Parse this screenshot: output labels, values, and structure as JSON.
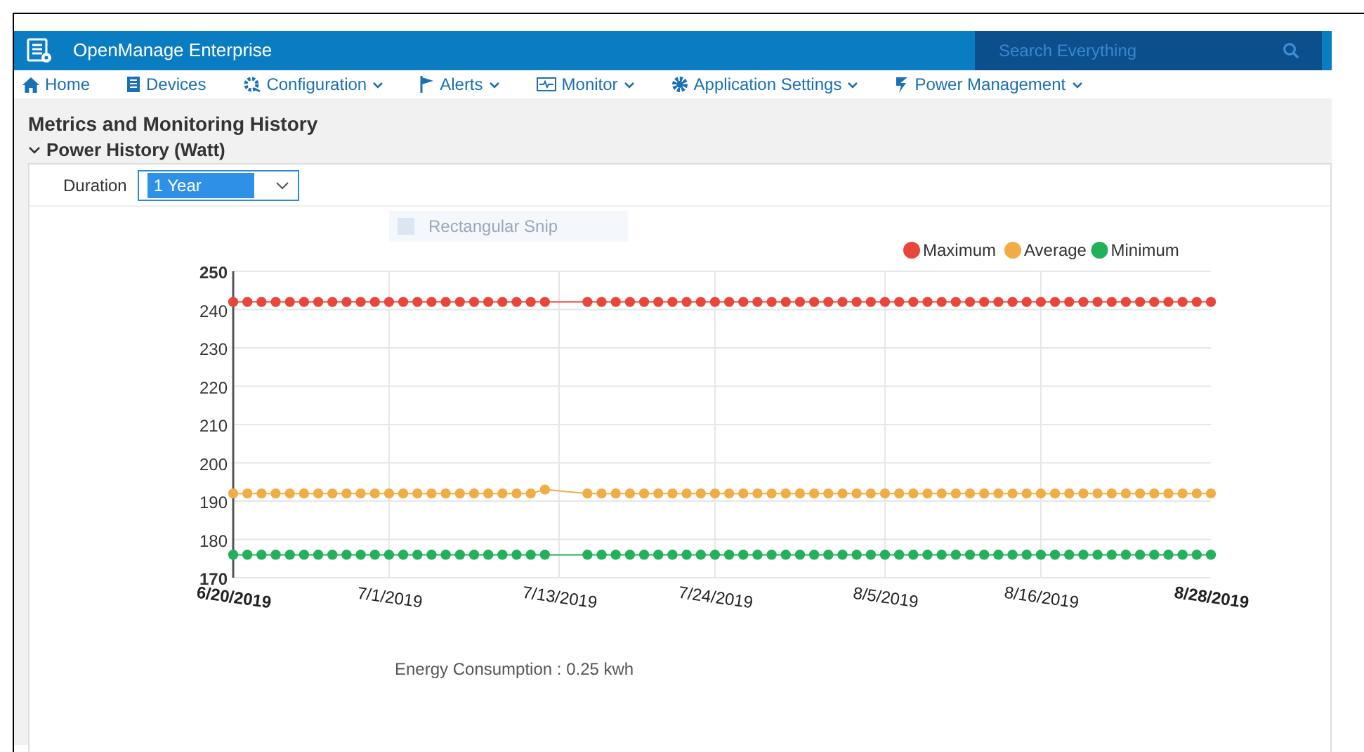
{
  "app": {
    "title": "OpenManage Enterprise",
    "search": {
      "placeholder": "Search Everything"
    }
  },
  "nav": [
    {
      "label": "Home",
      "dropdown": false
    },
    {
      "label": "Devices",
      "dropdown": false
    },
    {
      "label": "Configuration",
      "dropdown": true
    },
    {
      "label": "Alerts",
      "dropdown": true
    },
    {
      "label": "Monitor",
      "dropdown": true
    },
    {
      "label": "Application Settings",
      "dropdown": true
    },
    {
      "label": "Power Management",
      "dropdown": true
    }
  ],
  "page": {
    "title": "Metrics and Monitoring History"
  },
  "section": {
    "title": "Power History (Watt)",
    "expanded": true
  },
  "duration": {
    "label": "Duration",
    "value": "1 Year"
  },
  "snip_overlay": {
    "label": "Rectangular Snip"
  },
  "chart": {
    "chart_data": {
      "type": "line",
      "categories": [
        "6/20/2019",
        null,
        null,
        null,
        null,
        null,
        null,
        null,
        null,
        null,
        null,
        "7/1/2019",
        null,
        null,
        null,
        null,
        null,
        null,
        null,
        null,
        null,
        null,
        null,
        "7/13/2019",
        null,
        null,
        null,
        null,
        null,
        null,
        null,
        null,
        null,
        null,
        "7/24/2019",
        null,
        null,
        null,
        null,
        null,
        null,
        null,
        null,
        null,
        null,
        null,
        "8/5/2019",
        null,
        null,
        null,
        null,
        null,
        null,
        null,
        null,
        null,
        null,
        "8/16/2019",
        null,
        null,
        null,
        null,
        null,
        null,
        null,
        null,
        null,
        null,
        null,
        "8/28/2019"
      ],
      "series": [
        {
          "name": "Maximum",
          "color": "#e8463a",
          "marker": "circle",
          "values": [
            242,
            242,
            242,
            242,
            242,
            242,
            242,
            242,
            242,
            242,
            242,
            242,
            242,
            242,
            242,
            242,
            242,
            242,
            242,
            242,
            242,
            242,
            242,
            null,
            null,
            242,
            242,
            242,
            242,
            242,
            242,
            242,
            242,
            242,
            242,
            242,
            242,
            242,
            242,
            242,
            242,
            242,
            242,
            242,
            242,
            242,
            242,
            242,
            242,
            242,
            242,
            242,
            242,
            242,
            242,
            242,
            242,
            242,
            242,
            242,
            242,
            242,
            242,
            242,
            242,
            242,
            242,
            242,
            242,
            242
          ]
        },
        {
          "name": "Average",
          "color": "#f0ad45",
          "marker": "circle",
          "values": [
            192,
            192,
            192,
            192,
            192,
            192,
            192,
            192,
            192,
            192,
            192,
            192,
            192,
            192,
            192,
            192,
            192,
            192,
            192,
            192,
            192,
            192,
            193,
            null,
            null,
            192,
            192,
            192,
            192,
            192,
            192,
            192,
            192,
            192,
            192,
            192,
            192,
            192,
            192,
            192,
            192,
            192,
            192,
            192,
            192,
            192,
            192,
            192,
            192,
            192,
            192,
            192,
            192,
            192,
            192,
            192,
            192,
            192,
            192,
            192,
            192,
            192,
            192,
            192,
            192,
            192,
            192,
            192,
            192,
            192
          ]
        },
        {
          "name": "Minimum",
          "color": "#22b05a",
          "marker": "circle",
          "values": [
            176,
            176,
            176,
            176,
            176,
            176,
            176,
            176,
            176,
            176,
            176,
            176,
            176,
            176,
            176,
            176,
            176,
            176,
            176,
            176,
            176,
            176,
            176,
            null,
            null,
            176,
            176,
            176,
            176,
            176,
            176,
            176,
            176,
            176,
            176,
            176,
            176,
            176,
            176,
            176,
            176,
            176,
            176,
            176,
            176,
            176,
            176,
            176,
            176,
            176,
            176,
            176,
            176,
            176,
            176,
            176,
            176,
            176,
            176,
            176,
            176,
            176,
            176,
            176,
            176,
            176,
            176,
            176,
            176,
            176
          ]
        }
      ],
      "ylim": [
        170,
        250
      ],
      "grid": true,
      "legend": true,
      "yticks": [
        170,
        180,
        190,
        200,
        210,
        220,
        230,
        240,
        250
      ]
    },
    "energy": "Energy Consumption : 0.25 kwh"
  }
}
